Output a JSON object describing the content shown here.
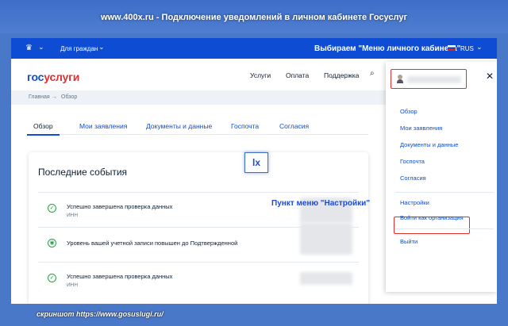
{
  "frame": {
    "title": "www.400x.ru - Подключение уведомлений в личном кабинете Госуслуг",
    "footer": "скриншот https://www.gosuslugi.ru/"
  },
  "topbar": {
    "audience": "Для граждан",
    "language": "RUS"
  },
  "annotations": {
    "menu_hint": "Выбираем \"Меню личного кабинета\"",
    "settings_hint": "Пункт меню \"Настройки\"",
    "watermark": "lx"
  },
  "logo": {
    "part1": "гос",
    "part2": "услуги"
  },
  "nav": [
    "Услуги",
    "Оплата",
    "Поддержка"
  ],
  "breadcrumb": {
    "home": "Главная",
    "current": "Обзор"
  },
  "tabs": [
    "Обзор",
    "Мои заявления",
    "Документы и данные",
    "Госпочта",
    "Согласия"
  ],
  "events": {
    "title": "Последние события",
    "items": [
      {
        "text": "Успешно завершена проверка данных",
        "sub": "ИНН"
      },
      {
        "text": "Уровень вашей учетной записи повышен до Подтвержденной",
        "sub": ""
      },
      {
        "text": "Успешно завершена проверка данных",
        "sub": "ИНН"
      }
    ]
  },
  "menu": {
    "items": [
      "Обзор",
      "Мои заявления",
      "Документы и данные",
      "Госпочта",
      "Согласия"
    ],
    "settings": "Настройки",
    "org": "Войти как организация",
    "logout": "Выйти"
  },
  "colors": {
    "brand_blue": "#0d4cd3",
    "brand_red": "#e52e2e",
    "success": "#2a9d4a"
  }
}
